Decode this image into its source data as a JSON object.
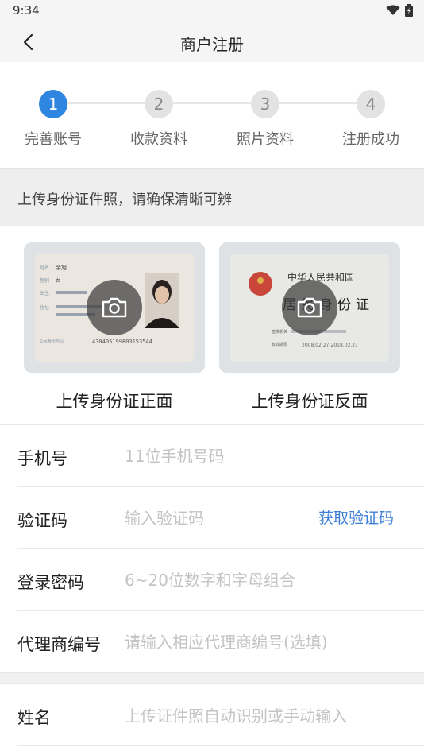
{
  "status_bar": {
    "time": "9:34"
  },
  "nav": {
    "title": "商户注册"
  },
  "steps": [
    {
      "number": "1",
      "label": "完善账号",
      "active": true
    },
    {
      "number": "2",
      "label": "收款资料",
      "active": false
    },
    {
      "number": "3",
      "label": "照片资料",
      "active": false
    },
    {
      "number": "4",
      "label": "注册成功",
      "active": false
    }
  ],
  "notice": {
    "text": "上传身份证件照，请确保清晰可辨"
  },
  "id_front": {
    "caption": "上传身份证正面",
    "card_name_label": "姓名",
    "card_name_value": "余旭",
    "card_sex_label": "性别",
    "card_sex_value": "女",
    "card_birth_label": "出生",
    "card_address_label": "住址",
    "card_id_label": "公民身份号码",
    "card_id_number": "430405199803153544"
  },
  "id_back": {
    "caption": "上传身份证反面",
    "country": "中华人民共和国",
    "card_title": "居民身份证",
    "authority_label": "签发机关",
    "validity_label": "有效期限",
    "validity_value": "2008.02.27-2018.02.27"
  },
  "form": {
    "phone": {
      "label": "手机号",
      "placeholder": "11位手机号码"
    },
    "code": {
      "label": "验证码",
      "placeholder": "输入验证码",
      "button": "获取验证码"
    },
    "password": {
      "label": "登录密码",
      "placeholder": "6~20位数字和字母组合"
    },
    "agent": {
      "label": "代理商编号",
      "placeholder": "请输入相应代理商编号(选填)"
    },
    "name": {
      "label": "姓名",
      "placeholder": "上传证件照自动识别或手动输入"
    }
  },
  "colors": {
    "accent": "#2e86e0",
    "link": "#3d7fd6"
  }
}
